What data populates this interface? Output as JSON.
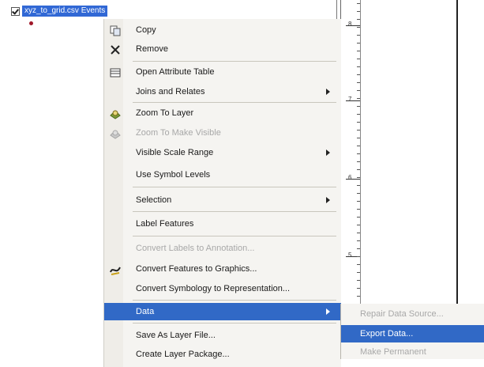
{
  "toc": {
    "layer_name": "xyz_to_grid.csv Events",
    "checked": true,
    "symbol_color": "#a0182a"
  },
  "context_menu": {
    "items": [
      {
        "label": "Copy",
        "icon": "copy-icon",
        "enabled": true,
        "submenu": false
      },
      {
        "label": "Remove",
        "icon": "remove-icon",
        "enabled": true,
        "submenu": false
      },
      {
        "label": "Open Attribute Table",
        "icon": "table-icon",
        "enabled": true,
        "submenu": false
      },
      {
        "label": "Joins and Relates",
        "icon": "",
        "enabled": true,
        "submenu": true
      },
      {
        "label": "Zoom To Layer",
        "icon": "zoom-to-layer-icon",
        "enabled": true,
        "submenu": false
      },
      {
        "label": "Zoom To Make Visible",
        "icon": "zoom-visible-icon",
        "enabled": false,
        "submenu": false
      },
      {
        "label": "Visible Scale Range",
        "icon": "",
        "enabled": true,
        "submenu": true
      },
      {
        "label": "Use Symbol Levels",
        "icon": "",
        "enabled": true,
        "submenu": false
      },
      {
        "label": "Selection",
        "icon": "",
        "enabled": true,
        "submenu": true
      },
      {
        "label": "Label Features",
        "icon": "",
        "enabled": true,
        "submenu": false
      },
      {
        "label": "Convert Labels to Annotation...",
        "icon": "",
        "enabled": false,
        "submenu": false
      },
      {
        "label": "Convert Features to Graphics...",
        "icon": "convert-graphics-icon",
        "enabled": true,
        "submenu": false
      },
      {
        "label": "Convert Symbology to Representation...",
        "icon": "",
        "enabled": true,
        "submenu": false
      },
      {
        "label": "Data",
        "icon": "",
        "enabled": true,
        "submenu": true,
        "active": true
      },
      {
        "label": "Save As Layer File...",
        "icon": "",
        "enabled": true,
        "submenu": false
      },
      {
        "label": "Create Layer Package...",
        "icon": "",
        "enabled": true,
        "submenu": false
      }
    ]
  },
  "data_submenu": {
    "items": [
      {
        "label": "Repair Data Source...",
        "enabled": false
      },
      {
        "label": "Export Data...",
        "enabled": true,
        "active": true
      },
      {
        "label": "Make Permanent",
        "enabled": false
      }
    ]
  },
  "ruler": {
    "labels": [
      "8",
      "7",
      "6",
      "5"
    ]
  },
  "colors": {
    "highlight": "#3169c6",
    "menu_background": "#f5f4f1"
  }
}
